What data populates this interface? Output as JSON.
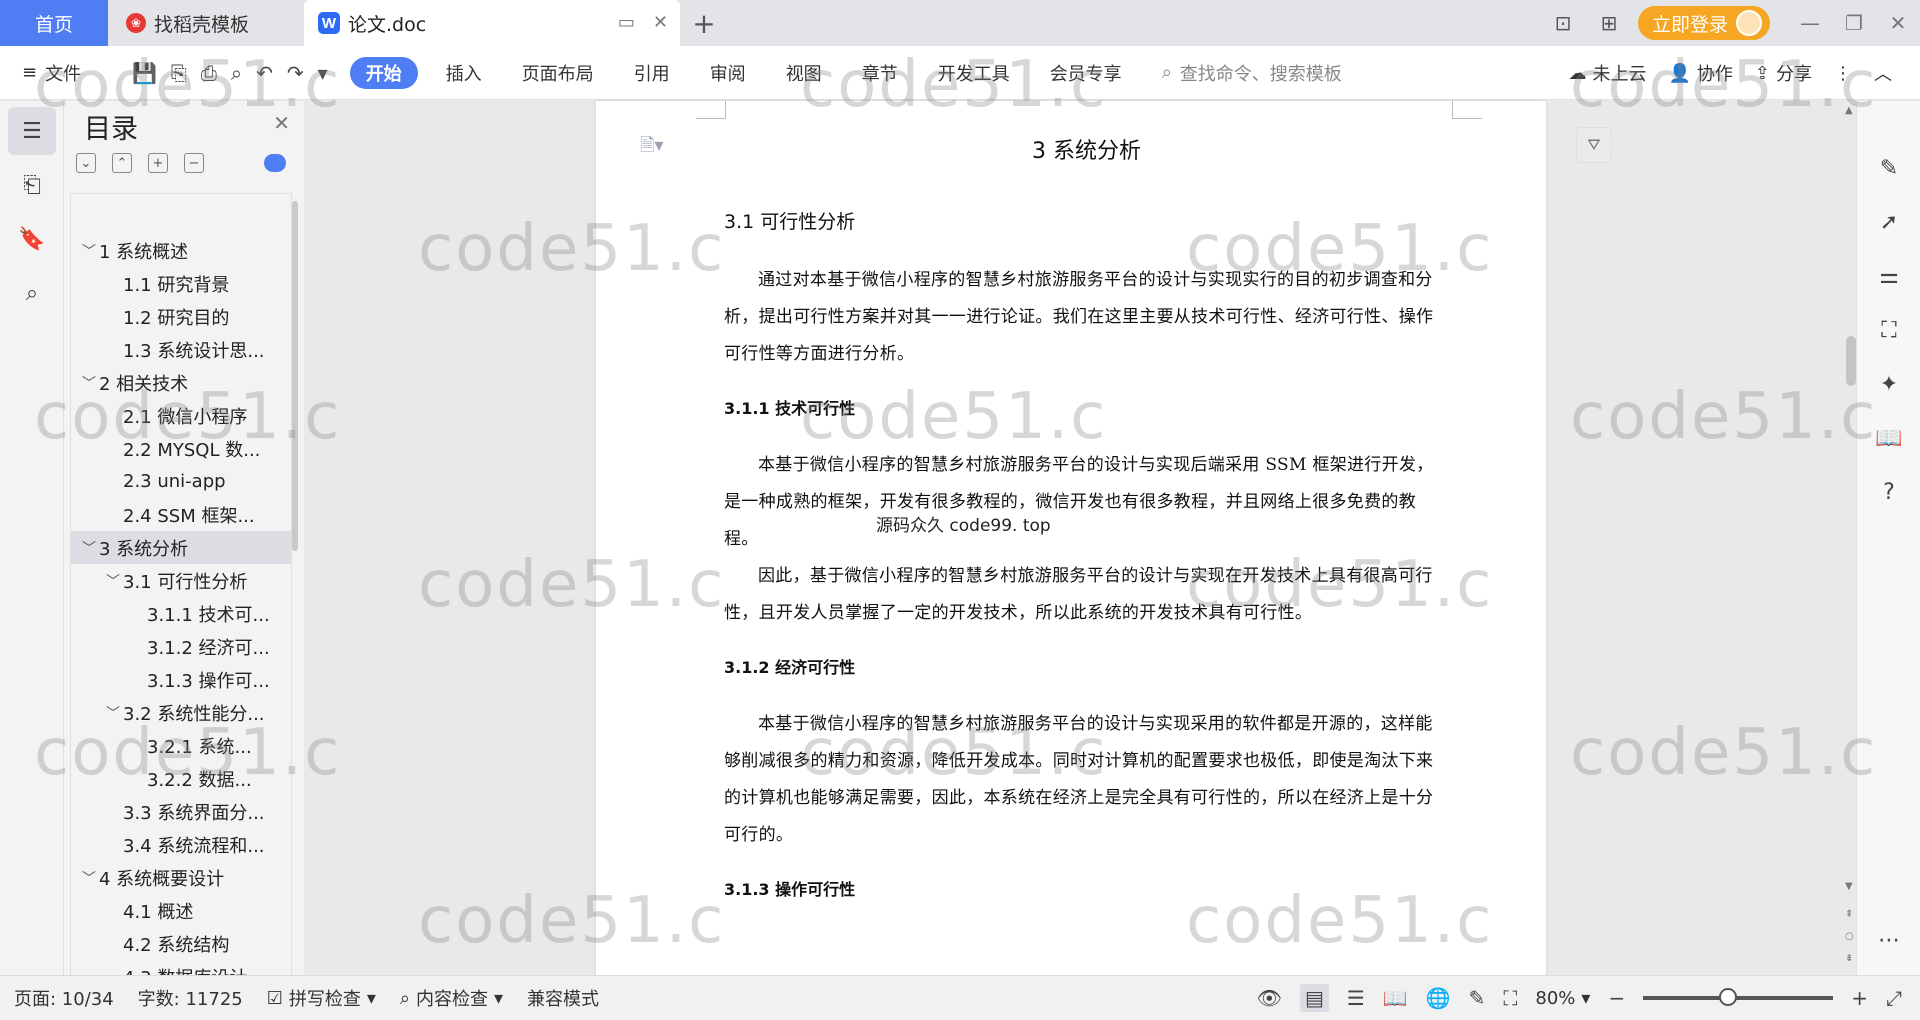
{
  "titlebar": {
    "tabs": [
      {
        "label": "首页"
      },
      {
        "label": "找稻壳模板"
      },
      {
        "label": "论文.doc"
      }
    ],
    "login_label": "立即登录"
  },
  "menubar": {
    "file_label": "文件",
    "tabs": [
      "开始",
      "插入",
      "页面布局",
      "引用",
      "审阅",
      "视图",
      "章节",
      "开发工具",
      "会员专享"
    ],
    "search_placeholder": "查找命令、搜索模板",
    "cloud_label": "未上云",
    "collab_label": "协作",
    "share_label": "分享"
  },
  "toc": {
    "title": "目录",
    "items": [
      {
        "label": "1 系统概述",
        "level": 1,
        "caret": "﹀"
      },
      {
        "label": "1.1 研究背景",
        "level": 2
      },
      {
        "label": "1.2 研究目的",
        "level": 2
      },
      {
        "label": "1.3 系统设计思...",
        "level": 2
      },
      {
        "label": "2 相关技术",
        "level": 1,
        "caret": "﹀"
      },
      {
        "label": "2.1 微信小程序",
        "level": 2
      },
      {
        "label": "2.2 MYSQL 数...",
        "level": 2
      },
      {
        "label": "2.3 uni-app",
        "level": 2
      },
      {
        "label": "2.4 SSM 框架...",
        "level": 2
      },
      {
        "label": "3 系统分析",
        "level": 1,
        "caret": "﹀",
        "selected": true
      },
      {
        "label": "3.1 可行性分析",
        "level": 2,
        "caret": "﹀"
      },
      {
        "label": "3.1.1 技术可...",
        "level": 3
      },
      {
        "label": "3.1.2 经济可...",
        "level": 3
      },
      {
        "label": "3.1.3 操作可...",
        "level": 3
      },
      {
        "label": "3.2 系统性能分...",
        "level": 2,
        "caret": "﹀"
      },
      {
        "label": "3.2.1 系统...",
        "level": 3
      },
      {
        "label": "3.2.2 数据...",
        "level": 3
      },
      {
        "label": "3.3 系统界面分...",
        "level": 2
      },
      {
        "label": "3.4 系统流程和...",
        "level": 2
      },
      {
        "label": "4 系统概要设计",
        "level": 1,
        "caret": "﹀"
      },
      {
        "label": "4.1 概述",
        "level": 2
      },
      {
        "label": "4.2 系统结构",
        "level": 2
      },
      {
        "label": "4.3 数据库设计",
        "level": 2
      }
    ]
  },
  "document": {
    "chapter_title": "3 系统分析",
    "h_31": "3.1 可行性分析",
    "p_31": "通过对本基于微信小程序的智慧乡村旅游服务平台的设计与实现实行的目的初步调查和分析，提出可行性方案并对其一一进行论证。我们在这里主要从技术可行性、经济可行性、操作可行性等方面进行分析。",
    "h_311": "3.1.1 技术可行性",
    "p_311a": "本基于微信小程序的智慧乡村旅游服务平台的设计与实现后端采用 SSM 框架进行开发，是一种成熟的框架，开发有很多教程的，微信开发也有很多教程，并且网络上很多免费的教程。",
    "p_311b": "因此，基于微信小程序的智慧乡村旅游服务平台的设计与实现在开发技术上具有很高可行性，且开发人员掌握了一定的开发技术，所以此系统的开发技术具有可行性。",
    "h_312": "3.1.2 经济可行性",
    "p_312": "本基于微信小程序的智慧乡村旅游服务平台的设计与实现采用的软件都是开源的，这样能够削减很多的精力和资源，降低开发成本。同时对计算机的配置要求也极低，即使是淘汰下来的计算机也能够满足需要，因此，本系统在经济上是完全具有可行性的，所以在经济上是十分可行的。",
    "h_313": "3.1.3 操作可行性",
    "float_note": "源码众久 code99. top"
  },
  "statusbar": {
    "page": "页面: 10/34",
    "words": "字数: 11725",
    "spell_check": "拼写检查",
    "content_check": "内容检查",
    "compat_mode": "兼容模式",
    "zoom": "80%"
  },
  "watermark": "code51.c"
}
